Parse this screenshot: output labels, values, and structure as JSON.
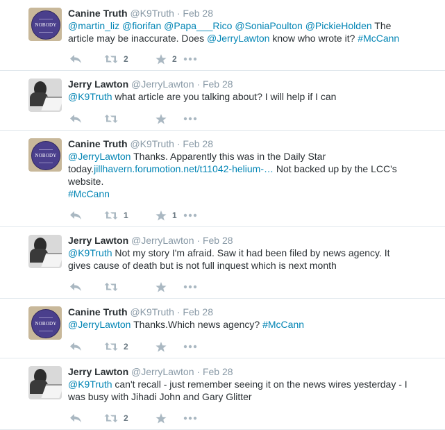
{
  "tweets": [
    {
      "author": "canine",
      "fullname": "Canine Truth",
      "username": "@K9Truth",
      "time": "Feb 28",
      "text": [
        {
          "t": "@martin_liz",
          "link": true
        },
        {
          "t": " ",
          "link": false
        },
        {
          "t": "@fiorifan",
          "link": true
        },
        {
          "t": " ",
          "link": false
        },
        {
          "t": "@Papa___Rico",
          "link": true
        },
        {
          "t": " ",
          "link": false
        },
        {
          "t": "@SoniaPoulton",
          "link": true
        },
        {
          "t": " ",
          "link": false
        },
        {
          "t": "@PickieHolden",
          "link": true
        },
        {
          "t": " The article may be inaccurate. Does ",
          "link": false
        },
        {
          "t": "@JerryLawton",
          "link": true
        },
        {
          "t": " know who wrote it? ",
          "link": false
        },
        {
          "t": "#McCann",
          "link": true
        }
      ],
      "retweets": "2",
      "favorites": "2"
    },
    {
      "author": "jerry",
      "fullname": "Jerry Lawton",
      "username": "@JerryLawton",
      "time": "Feb 28",
      "text": [
        {
          "t": "@K9Truth",
          "link": true
        },
        {
          "t": " what article are you talking about? I will help if I can",
          "link": false
        }
      ],
      "retweets": "",
      "favorites": ""
    },
    {
      "author": "canine",
      "fullname": "Canine Truth",
      "username": "@K9Truth",
      "time": "Feb 28",
      "text": [
        {
          "t": "@JerryLawton",
          "link": true
        },
        {
          "t": " Thanks. Apparently this was in the Daily Star today.",
          "link": false
        },
        {
          "t": "jillhavern.forumotion.net/t11042-helium-…",
          "link": true
        },
        {
          "t": " Not backed up by the LCC's website.",
          "link": false
        },
        {
          "t": "\n",
          "link": false
        },
        {
          "t": "#McCann",
          "link": true
        }
      ],
      "retweets": "1",
      "favorites": "1"
    },
    {
      "author": "jerry",
      "fullname": "Jerry Lawton",
      "username": "@JerryLawton",
      "time": "Feb 28",
      "text": [
        {
          "t": "@K9Truth",
          "link": true
        },
        {
          "t": " Not my story I'm afraid. Saw it had been filed by news agency. It gives cause of death but is not full inquest which is next month",
          "link": false
        }
      ],
      "retweets": "",
      "favorites": ""
    },
    {
      "author": "canine",
      "fullname": "Canine Truth",
      "username": "@K9Truth",
      "time": "Feb 28",
      "text": [
        {
          "t": "@JerryLawton",
          "link": true
        },
        {
          "t": " Thanks.Which news agency? ",
          "link": false
        },
        {
          "t": "#McCann",
          "link": true
        }
      ],
      "retweets": "2",
      "favorites": ""
    },
    {
      "author": "jerry",
      "fullname": "Jerry Lawton",
      "username": "@JerryLawton",
      "time": "Feb 28",
      "text": [
        {
          "t": "@K9Truth",
          "link": true
        },
        {
          "t": " can't recall - just remember seeing it on the news wires yesterday - I was busy with Jihadi John and Gary Glitter",
          "link": false
        }
      ],
      "retweets": "2",
      "favorites": ""
    }
  ],
  "avatar_canine_text": "NOBODY",
  "icons": [
    "reply-icon",
    "retweet-icon",
    "favorite-icon",
    "more-icon"
  ],
  "colors": {
    "link": "#0084b4",
    "muted": "#8899a6",
    "icon": "#aab8c2",
    "border": "#e1e8ed"
  }
}
